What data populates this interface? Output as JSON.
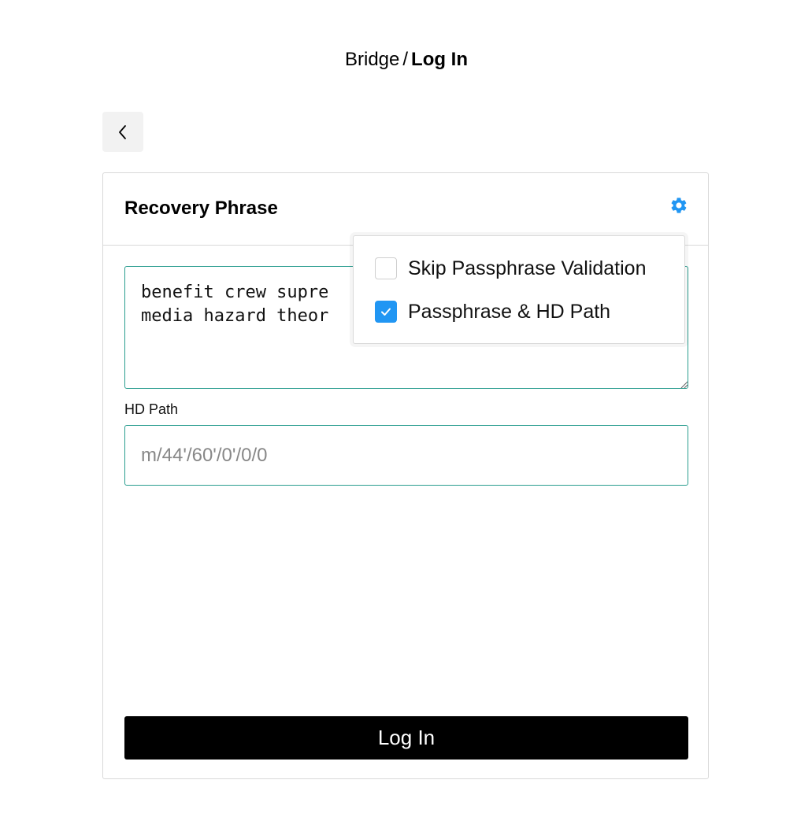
{
  "breadcrumb": {
    "parent": "Bridge",
    "separator": "/",
    "current": "Log In"
  },
  "back_button": {
    "icon": "chevron-left-icon"
  },
  "card": {
    "title": "Recovery Phrase",
    "settings_icon": "gear-icon",
    "accent_color": "#2196f3",
    "phrase_text": "benefit crew supre\nmedia hazard theor",
    "hd_path": {
      "label": "HD Path",
      "value": "",
      "placeholder": "m/44'/60'/0'/0/0"
    },
    "login_label": "Log In"
  },
  "dropdown": {
    "items": [
      {
        "label": "Skip Passphrase Validation",
        "checked": false
      },
      {
        "label": "Passphrase & HD Path",
        "checked": true
      }
    ]
  }
}
